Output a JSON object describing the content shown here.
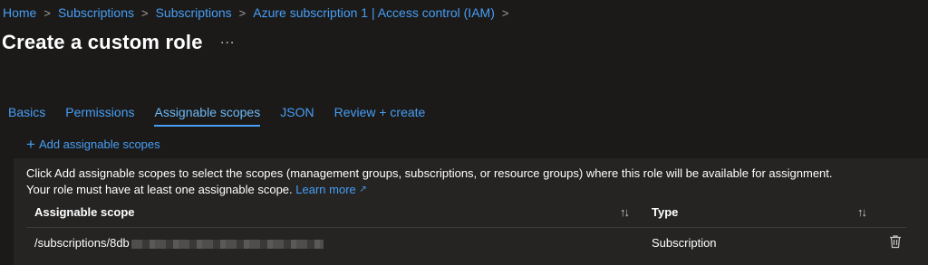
{
  "breadcrumb": [
    "Home",
    "Subscriptions",
    "Subscriptions",
    "Azure subscription 1 | Access control (IAM)"
  ],
  "breadcrumb_separator": ">",
  "page_title": "Create a custom role",
  "more_label": "...",
  "tabs": [
    {
      "label": "Basics",
      "active": false
    },
    {
      "label": "Permissions",
      "active": false
    },
    {
      "label": "Assignable scopes",
      "active": true
    },
    {
      "label": "JSON",
      "active": false
    },
    {
      "label": "Review + create",
      "active": false
    }
  ],
  "add_scopes_label": "Add assignable scopes",
  "info": {
    "line1": "Click Add assignable scopes to select the scopes (management groups, subscriptions, or resource groups) where this role will be available for assignment.",
    "line2": "Your role must have at least one assignable scope.",
    "learn_more": "Learn more"
  },
  "table": {
    "columns": [
      "Assignable scope",
      "Type"
    ],
    "rows": [
      {
        "scope": "/subscriptions/8db",
        "type": "Subscription"
      }
    ]
  },
  "icons": {
    "add": "plus-icon",
    "external": "external-link-icon",
    "sort": "sort-icon",
    "delete": "trash-icon"
  },
  "colors": {
    "background": "#1b1a19",
    "panel": "#252423",
    "link": "#479ef5",
    "text": "#ffffff"
  }
}
